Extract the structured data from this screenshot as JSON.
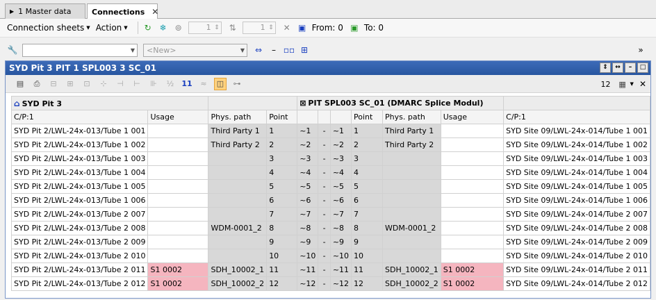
{
  "tabs": [
    {
      "label": "1 Master data",
      "active": false
    },
    {
      "label": "Connections",
      "active": true
    }
  ],
  "toolbar": {
    "connection_sheets": "Connection sheets",
    "action": "Action",
    "spin1": "1",
    "spin2": "1",
    "from": "From: 0",
    "to": "To: 0"
  },
  "filter": {
    "combo_value": "",
    "new_placeholder": "<New>"
  },
  "window": {
    "title": "SYD Pit 3 PIT 1 SPL003 3 SC_01",
    "count": "12"
  },
  "grid": {
    "left_header": "SYD Pit 3",
    "right_header": "PIT SPL003 SC_01 (DMARC Splice Modul)",
    "columns": [
      "C/P:1",
      "Usage",
      "Phys. path",
      "Point",
      "",
      "",
      "",
      "Point",
      "Phys. path",
      "Usage",
      "C/P:1"
    ],
    "rows": [
      {
        "cp_l": "SYD Pit 2/LWL-24x-013/Tube 1 001",
        "usage_l": "",
        "path_l": "Third Party 1",
        "pt_l": "1",
        "f_l": "~1",
        "d": "-",
        "f_r": "~1",
        "pt_r": "1",
        "path_r": "Third Party 1",
        "usage_r": "",
        "cp_r": "SYD Site 09/LWL-24x-014/Tube 1 001"
      },
      {
        "cp_l": "SYD Pit 2/LWL-24x-013/Tube 1 002",
        "usage_l": "",
        "path_l": "Third Party 2",
        "pt_l": "2",
        "f_l": "~2",
        "d": "-",
        "f_r": "~2",
        "pt_r": "2",
        "path_r": "Third Party 2",
        "usage_r": "",
        "cp_r": "SYD Site 09/LWL-24x-014/Tube 1 002"
      },
      {
        "cp_l": "SYD Pit 2/LWL-24x-013/Tube 1 003",
        "usage_l": "",
        "path_l": "",
        "pt_l": "3",
        "f_l": "~3",
        "d": "-",
        "f_r": "~3",
        "pt_r": "3",
        "path_r": "",
        "usage_r": "",
        "cp_r": "SYD Site 09/LWL-24x-014/Tube 1 003"
      },
      {
        "cp_l": "SYD Pit 2/LWL-24x-013/Tube 1 004",
        "usage_l": "",
        "path_l": "",
        "pt_l": "4",
        "f_l": "~4",
        "d": "-",
        "f_r": "~4",
        "pt_r": "4",
        "path_r": "",
        "usage_r": "",
        "cp_r": "SYD Site 09/LWL-24x-014/Tube 1 004"
      },
      {
        "cp_l": "SYD Pit 2/LWL-24x-013/Tube 1 005",
        "usage_l": "",
        "path_l": "",
        "pt_l": "5",
        "f_l": "~5",
        "d": "-",
        "f_r": "~5",
        "pt_r": "5",
        "path_r": "",
        "usage_r": "",
        "cp_r": "SYD Site 09/LWL-24x-014/Tube 1 005"
      },
      {
        "cp_l": "SYD Pit 2/LWL-24x-013/Tube 1 006",
        "usage_l": "",
        "path_l": "",
        "pt_l": "6",
        "f_l": "~6",
        "d": "-",
        "f_r": "~6",
        "pt_r": "6",
        "path_r": "",
        "usage_r": "",
        "cp_r": "SYD Site 09/LWL-24x-014/Tube 1 006"
      },
      {
        "cp_l": "SYD Pit 2/LWL-24x-013/Tube 2 007",
        "usage_l": "",
        "path_l": "",
        "pt_l": "7",
        "f_l": "~7",
        "d": "-",
        "f_r": "~7",
        "pt_r": "7",
        "path_r": "",
        "usage_r": "",
        "cp_r": "SYD Site 09/LWL-24x-014/Tube 2 007"
      },
      {
        "cp_l": "SYD Pit 2/LWL-24x-013/Tube 2 008",
        "usage_l": "",
        "path_l": "WDM-0001_2",
        "pt_l": "8",
        "f_l": "~8",
        "d": "-",
        "f_r": "~8",
        "pt_r": "8",
        "path_r": "WDM-0001_2",
        "usage_r": "",
        "cp_r": "SYD Site 09/LWL-24x-014/Tube 2 008"
      },
      {
        "cp_l": "SYD Pit 2/LWL-24x-013/Tube 2 009",
        "usage_l": "",
        "path_l": "",
        "pt_l": "9",
        "f_l": "~9",
        "d": "-",
        "f_r": "~9",
        "pt_r": "9",
        "path_r": "",
        "usage_r": "",
        "cp_r": "SYD Site 09/LWL-24x-014/Tube 2 009"
      },
      {
        "cp_l": "SYD Pit 2/LWL-24x-013/Tube 2 010",
        "usage_l": "",
        "path_l": "",
        "pt_l": "10",
        "f_l": "~10",
        "d": "-",
        "f_r": "~10",
        "pt_r": "10",
        "path_r": "",
        "usage_r": "",
        "cp_r": "SYD Site 09/LWL-24x-014/Tube 2 010"
      },
      {
        "cp_l": "SYD Pit 2/LWL-24x-013/Tube 2 011",
        "usage_l": "S1 0002",
        "path_l": "SDH_10002_1",
        "pt_l": "11",
        "f_l": "~11",
        "d": "-",
        "f_r": "~11",
        "pt_r": "11",
        "path_r": "SDH_10002_1",
        "usage_r": "S1 0002",
        "cp_r": "SYD Site 09/LWL-24x-014/Tube 2 011"
      },
      {
        "cp_l": "SYD Pit 2/LWL-24x-013/Tube 2 012",
        "usage_l": "S1 0002",
        "path_l": "SDH_10002_2",
        "pt_l": "12",
        "f_l": "~12",
        "d": "-",
        "f_r": "~12",
        "pt_r": "12",
        "path_r": "SDH_10002_2",
        "usage_r": "S1 0002",
        "cp_r": "SYD Site 09/LWL-24x-014/Tube 2 012"
      }
    ]
  },
  "colors": {
    "title_bar": "#2d5aa7",
    "usage_highlight": "#f5b5bf",
    "gray_cell": "#d8d8d8"
  }
}
